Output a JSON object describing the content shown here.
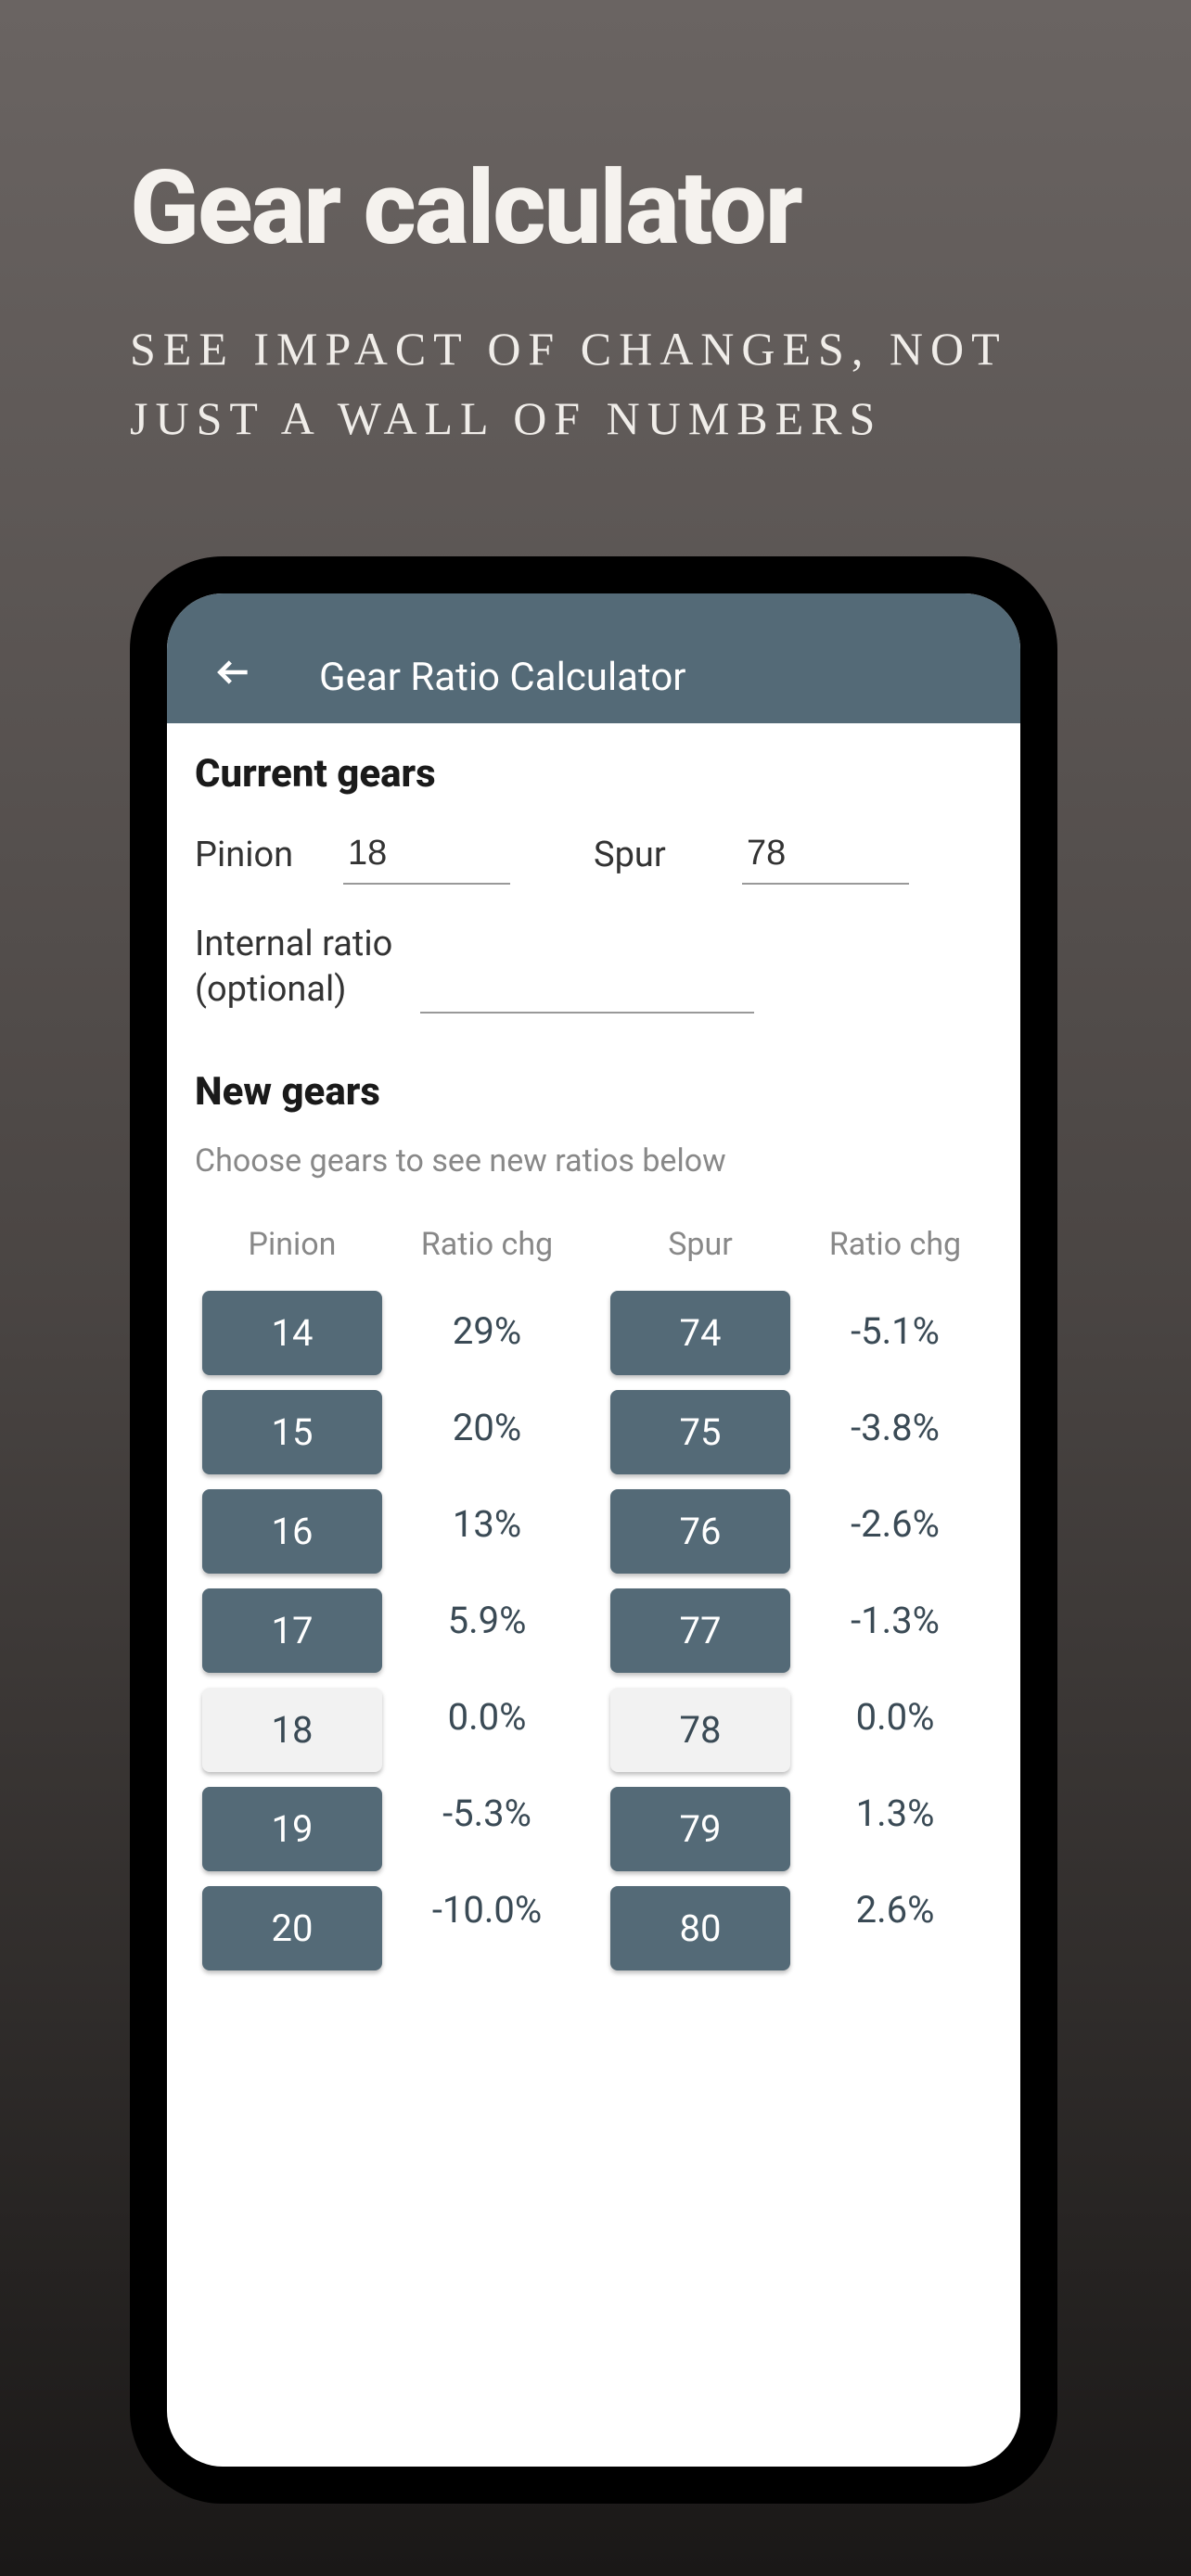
{
  "promo": {
    "title": "Gear calculator",
    "subtitle": "SEE IMPACT OF CHANGES, NOT JUST A WALL OF NUMBERS"
  },
  "app": {
    "title": "Gear Ratio Calculator"
  },
  "current_gears": {
    "heading": "Current gears",
    "pinion_label": "Pinion",
    "pinion_value": "18",
    "spur_label": "Spur",
    "spur_value": "78",
    "internal_ratio_label_1": "Internal ratio",
    "internal_ratio_label_2": "(optional)",
    "internal_ratio_value": ""
  },
  "new_gears": {
    "heading": "New gears",
    "subtitle": "Choose gears to see new ratios below",
    "headers": {
      "pinion": "Pinion",
      "ratio_chg_1": "Ratio chg",
      "spur": "Spur",
      "ratio_chg_2": "Ratio chg"
    },
    "pinion_rows": [
      {
        "gear": "14",
        "ratio": "29%",
        "selected": false
      },
      {
        "gear": "15",
        "ratio": "20%",
        "selected": false
      },
      {
        "gear": "16",
        "ratio": "13%",
        "selected": false
      },
      {
        "gear": "17",
        "ratio": "5.9%",
        "selected": false
      },
      {
        "gear": "18",
        "ratio": "0.0%",
        "selected": true
      },
      {
        "gear": "19",
        "ratio": "-5.3%",
        "selected": false
      },
      {
        "gear": "20",
        "ratio": "-10.0%",
        "selected": false
      }
    ],
    "spur_rows": [
      {
        "gear": "74",
        "ratio": "-5.1%",
        "selected": false
      },
      {
        "gear": "75",
        "ratio": "-3.8%",
        "selected": false
      },
      {
        "gear": "76",
        "ratio": "-2.6%",
        "selected": false
      },
      {
        "gear": "77",
        "ratio": "-1.3%",
        "selected": false
      },
      {
        "gear": "78",
        "ratio": "0.0%",
        "selected": true
      },
      {
        "gear": "79",
        "ratio": "1.3%",
        "selected": false
      },
      {
        "gear": "80",
        "ratio": "2.6%",
        "selected": false
      }
    ]
  }
}
